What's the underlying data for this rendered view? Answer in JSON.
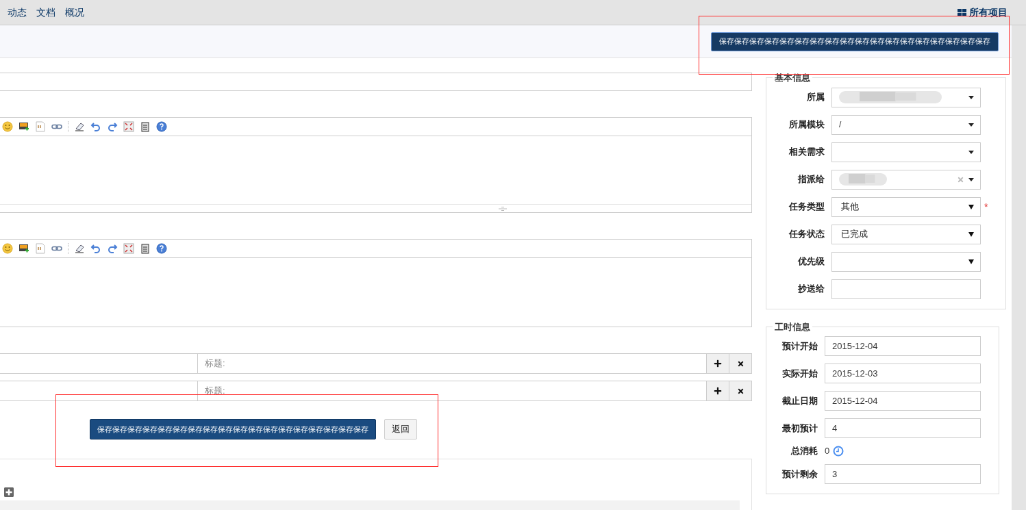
{
  "nav": {
    "links": [
      "动态",
      "文档",
      "概况"
    ],
    "all_projects": "所有项目"
  },
  "top_save_button": "保存保存保存保存保存保存保存保存保存保存保存保存保存保存保存保存保存保存",
  "editors": [
    {
      "resize_handle": true
    },
    {
      "resize_handle": false
    }
  ],
  "attachments": [
    {
      "placeholder": "标题:"
    },
    {
      "placeholder": "标题:"
    }
  ],
  "actions": {
    "save": "保存保存保存保存保存保存保存保存保存保存保存保存保存保存保存保存保存保存",
    "back": "返回"
  },
  "basic_info": {
    "title": "基本信息",
    "required_mark": "*",
    "fields": [
      {
        "label": "所属",
        "kind": "chosen",
        "blurred": true,
        "clearable": false,
        "required": false
      },
      {
        "label": "所属模块",
        "kind": "chosen",
        "value": "/",
        "blurred": false,
        "clearable": false,
        "required": false
      },
      {
        "label": "相关需求",
        "kind": "chosen",
        "blurred": false,
        "clearable": false,
        "required": false
      },
      {
        "label": "指派给",
        "kind": "chosen",
        "blurred": true,
        "clearable": true,
        "required": false
      },
      {
        "label": "任务类型",
        "kind": "select",
        "value": "其他",
        "blurred": false,
        "clearable": false,
        "required": true
      },
      {
        "label": "任务状态",
        "kind": "select",
        "value": "已完成",
        "blurred": false,
        "clearable": false,
        "required": false
      },
      {
        "label": "优先级",
        "kind": "select",
        "blurred": false,
        "clearable": false,
        "required": false
      },
      {
        "label": "抄送给",
        "kind": "input",
        "blurred": false,
        "clearable": false,
        "required": false
      }
    ]
  },
  "hours_info": {
    "title": "工时信息",
    "fields": [
      {
        "label": "预计开始",
        "kind": "input",
        "value": "2015-12-04"
      },
      {
        "label": "实际开始",
        "kind": "input",
        "value": "2015-12-03"
      },
      {
        "label": "截止日期",
        "kind": "input",
        "value": "2015-12-04"
      },
      {
        "label": "最初预计",
        "kind": "input",
        "value": "4"
      },
      {
        "label": "总消耗",
        "kind": "readout",
        "value": "0"
      },
      {
        "label": "预计剩余",
        "kind": "input",
        "value": "3"
      }
    ]
  }
}
